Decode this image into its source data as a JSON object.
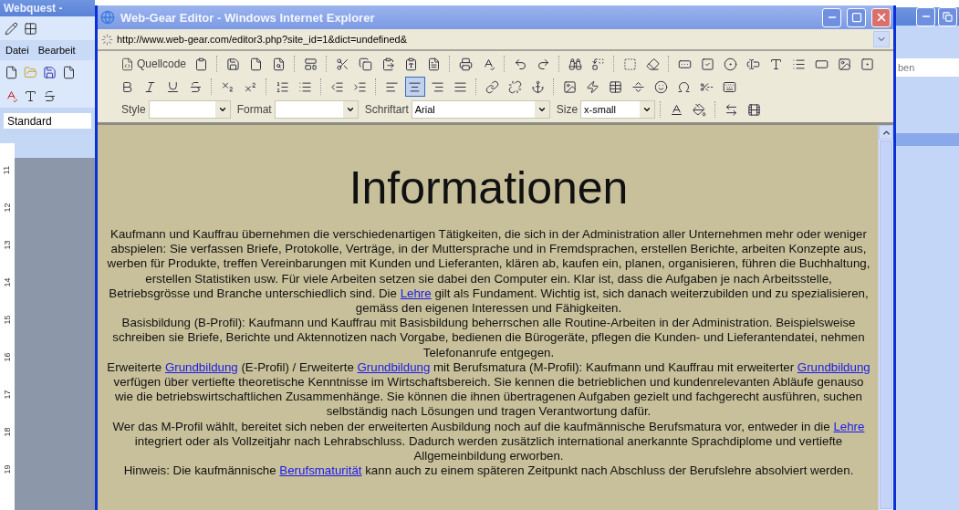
{
  "background_window_left": {
    "title": "Webquest -",
    "menu": [
      "Datei",
      "Bearbeit"
    ],
    "style_field": "Standard",
    "ruler": [
      "11",
      "12",
      "13",
      "14",
      "15",
      "16",
      "17",
      "18",
      "19"
    ]
  },
  "window": {
    "title": "Web-Gear Editor - Windows Internet Explorer"
  },
  "address_bar": {
    "url": "http://www.web-gear.com/editor3.php?site_id=1&dict=undefined&"
  },
  "toolbar": {
    "source_button": "Quellcode",
    "alignment": [
      {
        "selected": false
      },
      {
        "selected": true
      },
      {
        "selected": false
      },
      {
        "selected": false
      }
    ],
    "selects": [
      {
        "label": "Style"
      },
      {
        "label": "Format"
      },
      {
        "label": "Schriftart",
        "value": "Arial"
      },
      {
        "label": "Size",
        "value": "x-small"
      }
    ]
  },
  "document": {
    "heading": "Informationen",
    "paragraphs": [
      [
        {
          "kind": "text",
          "text": "Kaufmann und Kauffrau übernehmen die verschiedenartigen Tätigkeiten, die sich in der Administration aller Unternehmen mehr oder weniger abspielen: Sie verfassen Briefe, Protokolle, Verträge, in der Muttersprache und in Fremdsprachen, erstellen Berichte, arbeiten Konzepte aus, werben für Produkte, treffen Vereinbarungen mit Kunden und Lieferanten, klären ab, kaufen ein, planen, organisieren, führen die Buchhaltung, erstellen Statistiken usw. Für viele Arbeiten setzen sie dabei den Computer ein. Klar ist, dass die Aufgaben je nach Arbeitsstelle, Betriebsgrösse und Branche unterschiedlich sind. Die "
        },
        {
          "kind": "link",
          "text": "Lehre"
        },
        {
          "kind": "text",
          "text": " gilt als Fundament. Wichtig ist, sich danach weiterzubilden und zu spezialisieren, gemäss den eigenen Interessen und Fähigkeiten."
        }
      ],
      [
        {
          "kind": "text",
          "text": "Basisbildung (B-Profil): Kaufmann und Kauffrau mit Basisbildung beherrschen alle Routine-Arbeiten in der Administration. Beispielsweise schreiben sie Briefe, Berichte und Aktennotizen nach Vorgabe, bedienen die Bürogeräte, pflegen die Kunden- und Lieferantendatei, nehmen Telefonanrufe entgegen."
        }
      ],
      [
        {
          "kind": "text",
          "text": "Erweiterte "
        },
        {
          "kind": "link",
          "text": "Grundbildung"
        },
        {
          "kind": "text",
          "text": " (E-Profil) / Erweiterte "
        },
        {
          "kind": "link",
          "text": "Grundbildung"
        },
        {
          "kind": "text",
          "text": " mit Berufsmatura (M-Profil): Kaufmann und Kauffrau mit erweiterter "
        },
        {
          "kind": "link",
          "text": "Grundbildung"
        },
        {
          "kind": "text",
          "text": " verfügen über vertiefte theoretische Kenntnisse im Wirtschaftsbereich. Sie kennen die betrieblichen und kundenrelevanten Abläufe genauso wie die betriebswirtschaftlichen Zusammenhänge. Sie können die ihnen übertragenen Aufgaben gezielt und fachgerecht ausführen, suchen selbständig nach Lösungen und tragen Verantwortung dafür."
        }
      ],
      [
        {
          "kind": "text",
          "text": "Wer das M-Profil wählt, bereitet sich neben der erweiterten Ausbildung noch auf die kaufmännische Berufsmatura vor, entweder in die "
        },
        {
          "kind": "link",
          "text": "Lehre"
        },
        {
          "kind": "text",
          "text": " integriert oder als Vollzeitjahr nach Lehrabschluss. Dadurch werden zusätzlich international anerkannte Sprachdiplome und vertiefte Allgemeinbildung erworben."
        }
      ],
      [
        {
          "kind": "text",
          "text": "Hinweis: Die kaufmännische "
        },
        {
          "kind": "link",
          "text": "Berufsmaturität"
        },
        {
          "kind": "text",
          "text": " kann auch zu einem späteren Zeitpunkt nach Abschluss der Berufslehre absolviert werden."
        }
      ]
    ]
  },
  "background_window_right": {
    "field_value": "ben"
  }
}
